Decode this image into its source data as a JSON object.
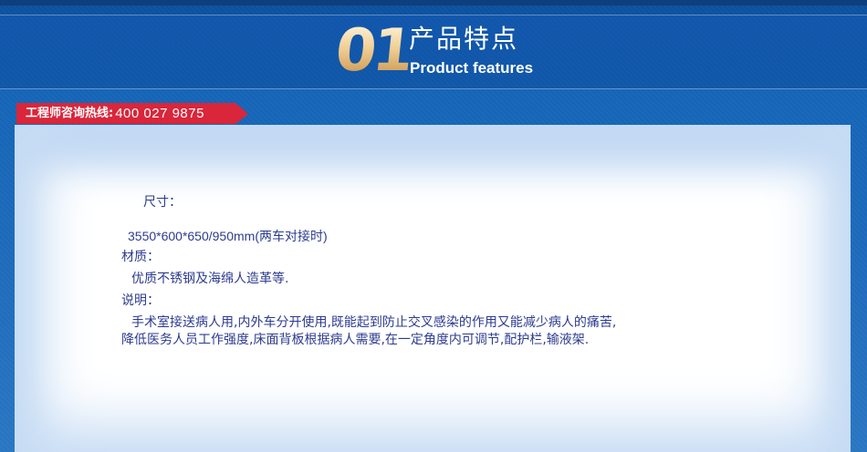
{
  "section": {
    "number": "01",
    "title_cn": "产品特点",
    "title_en": "Product features"
  },
  "hotline": {
    "label": "工程师咨询热线:",
    "number": "400 027 9875"
  },
  "specs": {
    "size_label": "尺寸：",
    "size_value": "3550*600*650/950mm(两车对接时)",
    "material_label": "材质：",
    "material_value": "优质不锈钢及海绵人造革等.",
    "description_label": "说明：",
    "description_line1": "手术室接送病人用,内外车分开使用,既能起到防止交叉感染的作用又能减少病人的痛苦,",
    "description_line2": "降低医务人员工作强度,床面背板根据病人需要,在一定角度内可调节,配护栏,输液架."
  },
  "colors": {
    "header_blue": "#1565b8",
    "hotline_red": "#d9263a",
    "text_blue": "#2d3b8f",
    "number_gold": "#e8c48a"
  }
}
